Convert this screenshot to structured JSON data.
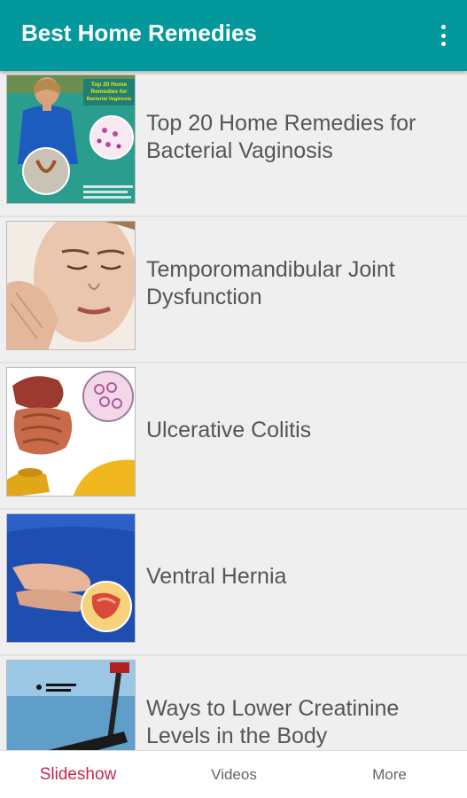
{
  "appbar": {
    "title": "Best Home Remedies",
    "menu_icon": "more-vert-icon",
    "color": "#03989b"
  },
  "items": [
    {
      "title": "Top 20 Home Remedies for Bacterial Vaginosis",
      "thumb_text": [
        "Top 20 Home",
        "Remedies for",
        "Bacterial Vaginosis"
      ]
    },
    {
      "title": "Temporomandibular Joint Dysfunction"
    },
    {
      "title": "Ulcerative Colitis"
    },
    {
      "title": "Ventral Hernia"
    },
    {
      "title": "Ways to Lower Creatinine Levels in the Body"
    }
  ],
  "bottom_nav": {
    "tabs": [
      {
        "label": "Slideshow",
        "active": true
      },
      {
        "label": "Videos",
        "active": false
      },
      {
        "label": "More",
        "active": false
      }
    ],
    "active_color": "#c8264f"
  }
}
